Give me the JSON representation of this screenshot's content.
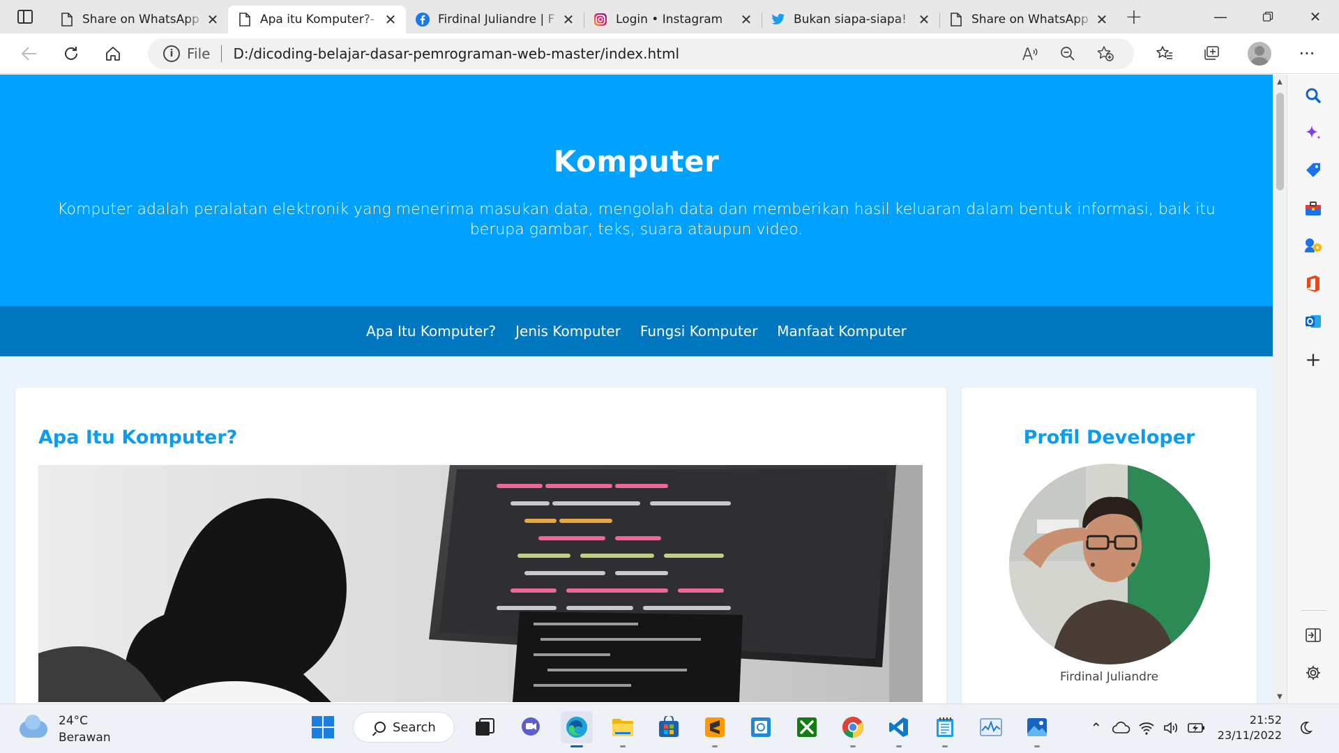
{
  "browser": {
    "tabs": [
      {
        "title": "Share on WhatsApp",
        "favicon": "page-icon",
        "active": false
      },
      {
        "title": "Apa itu Komputer?-",
        "favicon": "page-icon",
        "active": true
      },
      {
        "title": "Firdinal Juliandre | F",
        "favicon": "facebook-icon",
        "active": false
      },
      {
        "title": "Login • Instagram",
        "favicon": "instagram-icon",
        "active": false
      },
      {
        "title": "Bukan siapa-siapa!",
        "favicon": "twitter-icon",
        "active": false
      },
      {
        "title": "Share on WhatsApp",
        "favicon": "page-icon",
        "active": false
      }
    ],
    "address": {
      "scheme_label": "File",
      "url": "D:/dicoding-belajar-dasar-pemrograman-web-master/index.html"
    }
  },
  "page": {
    "hero": {
      "title": "Komputer",
      "description": "Komputer adalah peralatan elektronik yang menerima masukan data, mengolah data dan memberikan hasil keluaran dalam bentuk informasi, baik itu berupa gambar, teks, suara ataupun video."
    },
    "nav": [
      "Apa Itu Komputer?",
      "Jenis Komputer",
      "Fungsi Komputer",
      "Manfaat Komputer"
    ],
    "main_card": {
      "heading": "Apa Itu Komputer?"
    },
    "side_card": {
      "heading": "Profil Developer",
      "name": "Firdinal Juliandre"
    },
    "colors": {
      "hero_bg": "#00a1ff",
      "nav_bg": "#0077be",
      "heading": "#0b9bf0",
      "page_bg": "#ebf3fd"
    }
  },
  "taskbar": {
    "weather": {
      "temp": "24°C",
      "condition": "Berawan"
    },
    "search_label": "Search",
    "clock": {
      "time": "21:52",
      "date": "23/11/2022"
    }
  }
}
